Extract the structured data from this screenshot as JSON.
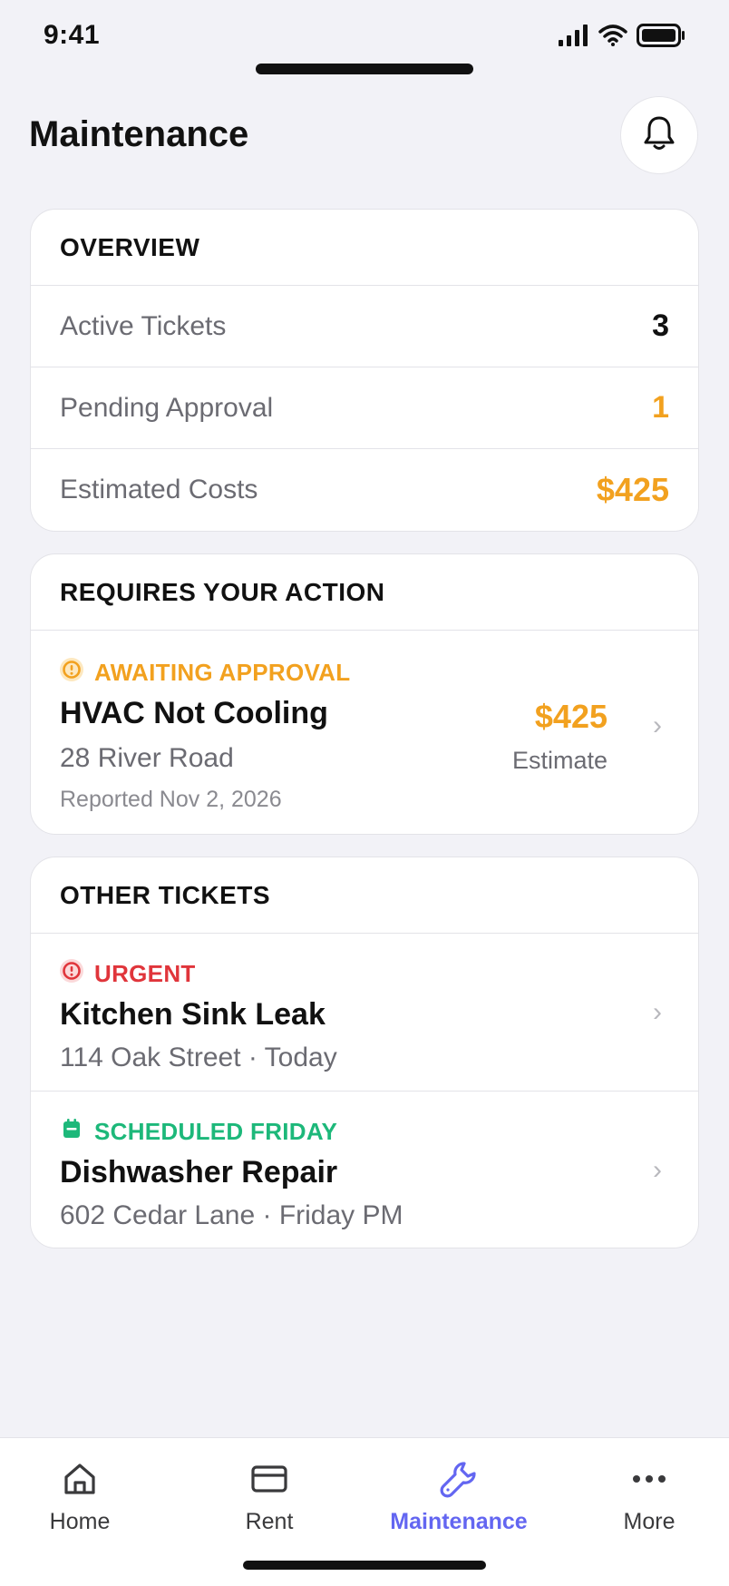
{
  "status_bar": {
    "time": "9:41"
  },
  "header": {
    "title": "Maintenance"
  },
  "overview": {
    "title": "OVERVIEW",
    "rows": [
      {
        "label": "Active Tickets",
        "value": "3"
      },
      {
        "label": "Pending Approval",
        "value": "1"
      },
      {
        "label": "Estimated Costs",
        "value": "$425"
      }
    ]
  },
  "action": {
    "title": "REQUIRES YOUR ACTION",
    "ticket": {
      "status": "AWAITING APPROVAL",
      "title": "HVAC Not Cooling",
      "address": "28 River Road",
      "reported": "Reported Nov 2, 2026",
      "amount": "$425",
      "amount_label": "Estimate"
    }
  },
  "other": {
    "title": "OTHER TICKETS",
    "tickets": [
      {
        "status": "URGENT",
        "title": "Kitchen Sink Leak",
        "sub": "114 Oak Street · Today"
      },
      {
        "status": "SCHEDULED FRIDAY",
        "title": "Dishwasher Repair",
        "sub": "602 Cedar Lane · Friday PM"
      }
    ]
  },
  "tabs": [
    {
      "label": "Home",
      "icon": "home-icon"
    },
    {
      "label": "Rent",
      "icon": "card-icon"
    },
    {
      "label": "Maintenance",
      "icon": "wrench-icon",
      "active": true
    },
    {
      "label": "More",
      "icon": "more-icon"
    }
  ],
  "colors": {
    "accent": "#6366f1",
    "warning": "#f2a11f",
    "danger": "#e0353b",
    "success": "#1db87a",
    "background": "#f2f2f7"
  }
}
